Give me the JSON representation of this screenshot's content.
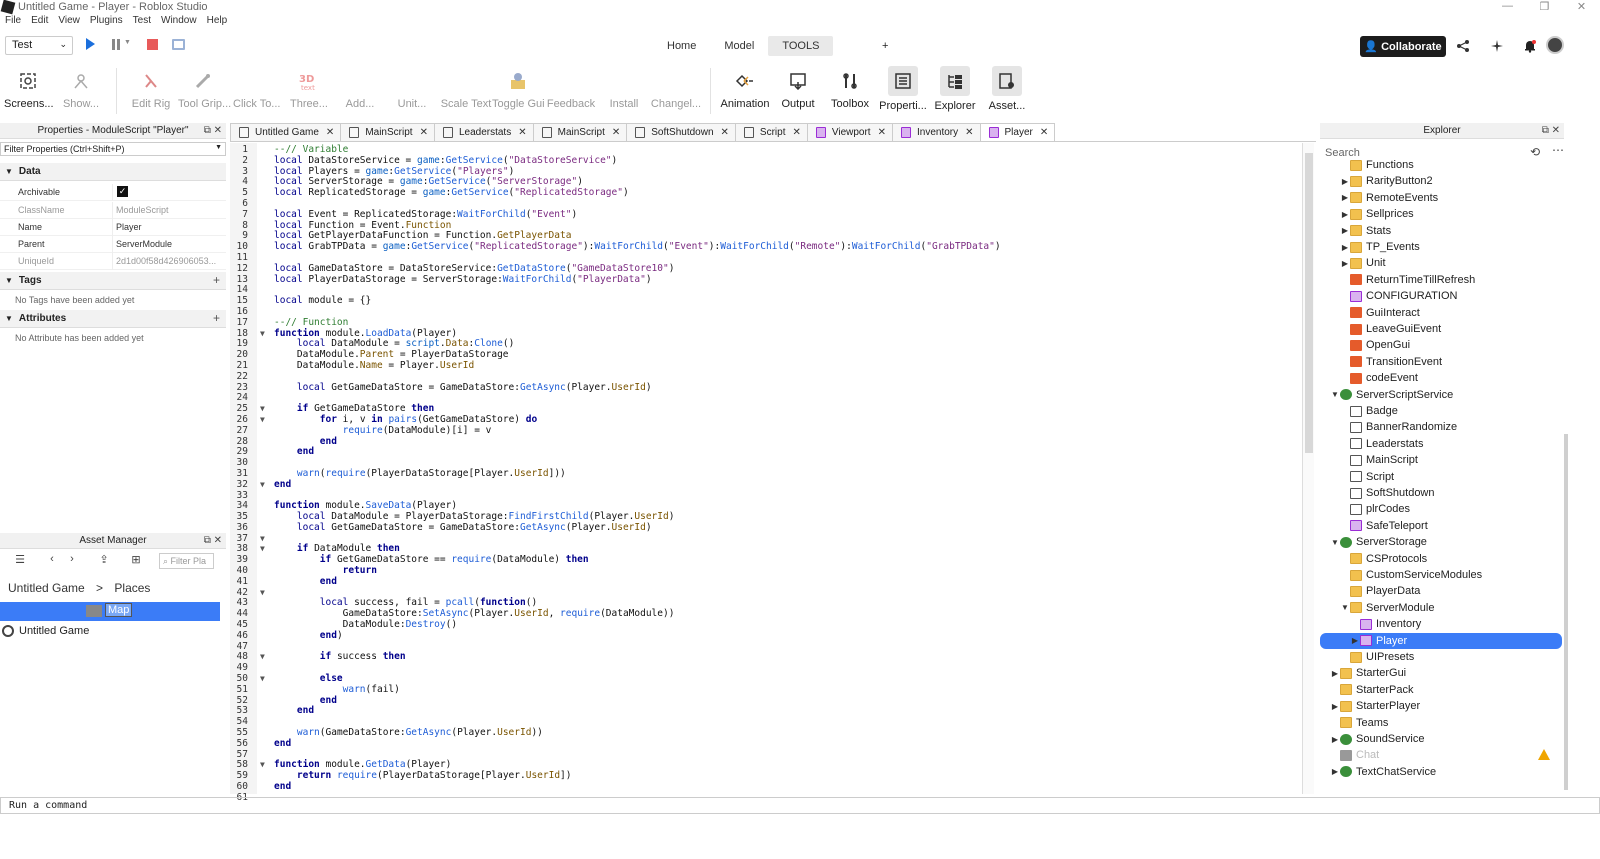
{
  "window": {
    "title": "Untitled Game - Player - Roblox Studio",
    "controls": [
      "—",
      "❐",
      "✕"
    ]
  },
  "menu": [
    "File",
    "Edit",
    "View",
    "Plugins",
    "Test",
    "Window",
    "Help"
  ],
  "toolbar_top": {
    "mode": "Test",
    "tabs": [
      {
        "label": "Home"
      },
      {
        "label": "Model"
      },
      {
        "label": "TOOLS"
      }
    ],
    "plus": "+",
    "collaborate": "Collaborate"
  },
  "ribbon": [
    {
      "label": "Screens...",
      "icon": "screenshot-icon",
      "active": true
    },
    {
      "label": "Show...",
      "icon": "show-icon",
      "active": false
    },
    {
      "label": "Edit Rig",
      "icon": "edit-rig-icon",
      "active": false
    },
    {
      "label": "Tool Grip...",
      "icon": "tool-grip-icon",
      "active": false
    },
    {
      "label": "Click To...",
      "icon": "click-to-icon",
      "active": false
    },
    {
      "label": "Three...",
      "icon": "three-d-text-icon",
      "active": false
    },
    {
      "label": "Add...",
      "icon": "add-icon",
      "active": false
    },
    {
      "label": "Unit...",
      "icon": "unit-icon",
      "active": false
    },
    {
      "label": "Scale Text",
      "icon": "scale-text-icon",
      "active": false
    },
    {
      "label": "Toggle Gui",
      "icon": "toggle-gui-icon",
      "active": false
    },
    {
      "label": "Feedback",
      "icon": "feedback-icon",
      "active": false
    },
    {
      "label": "Install",
      "icon": "install-icon",
      "active": false
    },
    {
      "label": "Changel...",
      "icon": "changelog-icon",
      "active": false
    },
    {
      "label": "Animation",
      "icon": "animation-icon",
      "active": true
    },
    {
      "label": "Output",
      "icon": "output-icon",
      "active": true
    },
    {
      "label": "Toolbox",
      "icon": "toolbox-icon",
      "active": true
    },
    {
      "label": "Properti...",
      "icon": "properties-icon",
      "active": true
    },
    {
      "label": "Explorer",
      "icon": "explorer-icon",
      "active": true
    },
    {
      "label": "Asset...",
      "icon": "asset-manager-icon",
      "active": true
    }
  ],
  "properties": {
    "header": "Properties - ModuleScript \"Player\"",
    "filter": "Filter Properties (Ctrl+Shift+P)",
    "sections": {
      "data": "Data",
      "tags": "Tags",
      "attributes": "Attributes"
    },
    "rows": [
      {
        "key": "Archivable",
        "value": "✓"
      },
      {
        "key": "ClassName",
        "value": "ModuleScript"
      },
      {
        "key": "Name",
        "value": "Player"
      },
      {
        "key": "Parent",
        "value": "ServerModule"
      },
      {
        "key": "UniqueId",
        "value": "2d1d00f58d426906053..."
      }
    ],
    "no_tags": "No Tags have been added yet",
    "no_attributes": "No Attribute has been added yet"
  },
  "asset_manager": {
    "header": "Asset Manager",
    "search_placeholder": "Filter Pla",
    "crumb_root": "Untitled Game",
    "crumb_sep": ">",
    "crumb_current": "Places",
    "selected": "Map",
    "item": "Untitled Game"
  },
  "tabs": [
    {
      "label": "Untitled Game"
    },
    {
      "label": "MainScript"
    },
    {
      "label": "Leaderstats"
    },
    {
      "label": "MainScript"
    },
    {
      "label": "SoftShutdown"
    },
    {
      "label": "Script"
    },
    {
      "label": "Viewport"
    },
    {
      "label": "Inventory"
    },
    {
      "label": "Player"
    }
  ],
  "code_line_count": 61,
  "command_bar": "Run a command",
  "explorer": {
    "header": "Explorer",
    "search_placeholder": "Search",
    "nodes": [
      {
        "label": "Functions",
        "indent": 2,
        "icon": "folder"
      },
      {
        "label": "RarityButton2",
        "indent": 2,
        "icon": "folder",
        "arrow": "▶"
      },
      {
        "label": "RemoteEvents",
        "indent": 2,
        "icon": "folder",
        "arrow": "▶"
      },
      {
        "label": "Sellprices",
        "indent": 2,
        "icon": "folder",
        "arrow": "▶"
      },
      {
        "label": "Stats",
        "indent": 2,
        "icon": "folder",
        "arrow": "▶"
      },
      {
        "label": "TP_Events",
        "indent": 2,
        "icon": "folder",
        "arrow": "▶"
      },
      {
        "label": "Unit",
        "indent": 2,
        "icon": "folder",
        "arrow": "▶"
      },
      {
        "label": "ReturnTimeTillRefresh",
        "indent": 2,
        "icon": "remote"
      },
      {
        "label": "CONFIGURATION",
        "indent": 2,
        "icon": "mod"
      },
      {
        "label": "GuiInteract",
        "indent": 2,
        "icon": "remote"
      },
      {
        "label": "LeaveGuiEvent",
        "indent": 2,
        "icon": "remote"
      },
      {
        "label": "OpenGui",
        "indent": 2,
        "icon": "remote"
      },
      {
        "label": "TransitionEvent",
        "indent": 2,
        "icon": "remote"
      },
      {
        "label": "codeEvent",
        "indent": 2,
        "icon": "remote"
      },
      {
        "label": "ServerScriptService",
        "indent": 1,
        "icon": "svc",
        "arrow": "▼"
      },
      {
        "label": "Badge",
        "indent": 2,
        "icon": "script"
      },
      {
        "label": "BannerRandomize",
        "indent": 2,
        "icon": "script"
      },
      {
        "label": "Leaderstats",
        "indent": 2,
        "icon": "script"
      },
      {
        "label": "MainScript",
        "indent": 2,
        "icon": "script"
      },
      {
        "label": "Script",
        "indent": 2,
        "icon": "script"
      },
      {
        "label": "SoftShutdown",
        "indent": 2,
        "icon": "script"
      },
      {
        "label": "plrCodes",
        "indent": 2,
        "icon": "script"
      },
      {
        "label": "SafeTeleport",
        "indent": 2,
        "icon": "mod"
      },
      {
        "label": "ServerStorage",
        "indent": 1,
        "icon": "svc",
        "arrow": "▼"
      },
      {
        "label": "CSProtocols",
        "indent": 2,
        "icon": "folder"
      },
      {
        "label": "CustomServiceModules",
        "indent": 2,
        "icon": "folder"
      },
      {
        "label": "PlayerData",
        "indent": 2,
        "icon": "folder"
      },
      {
        "label": "ServerModule",
        "indent": 2,
        "icon": "folder",
        "arrow": "▼"
      },
      {
        "label": "Inventory",
        "indent": 3,
        "icon": "mod"
      },
      {
        "label": "Player",
        "indent": 3,
        "icon": "mod",
        "arrow": "▶",
        "selected": true
      },
      {
        "label": "UIPresets",
        "indent": 2,
        "icon": "folder"
      },
      {
        "label": "StarterGui",
        "indent": 1,
        "icon": "folder",
        "arrow": "▶"
      },
      {
        "label": "StarterPack",
        "indent": 1,
        "icon": "folder"
      },
      {
        "label": "StarterPlayer",
        "indent": 1,
        "icon": "folder",
        "arrow": "▶"
      },
      {
        "label": "Teams",
        "indent": 1,
        "icon": "folder"
      },
      {
        "label": "SoundService",
        "indent": 1,
        "icon": "svc",
        "arrow": "▶"
      },
      {
        "label": "Chat",
        "indent": 1,
        "icon": "gray",
        "dim": true
      },
      {
        "label": "TextChatService",
        "indent": 1,
        "icon": "svc",
        "arrow": "▶"
      }
    ]
  },
  "colors": {
    "accent": "#3b7cf7",
    "play": "#1b6fdc",
    "stop": "#e85a5a"
  }
}
